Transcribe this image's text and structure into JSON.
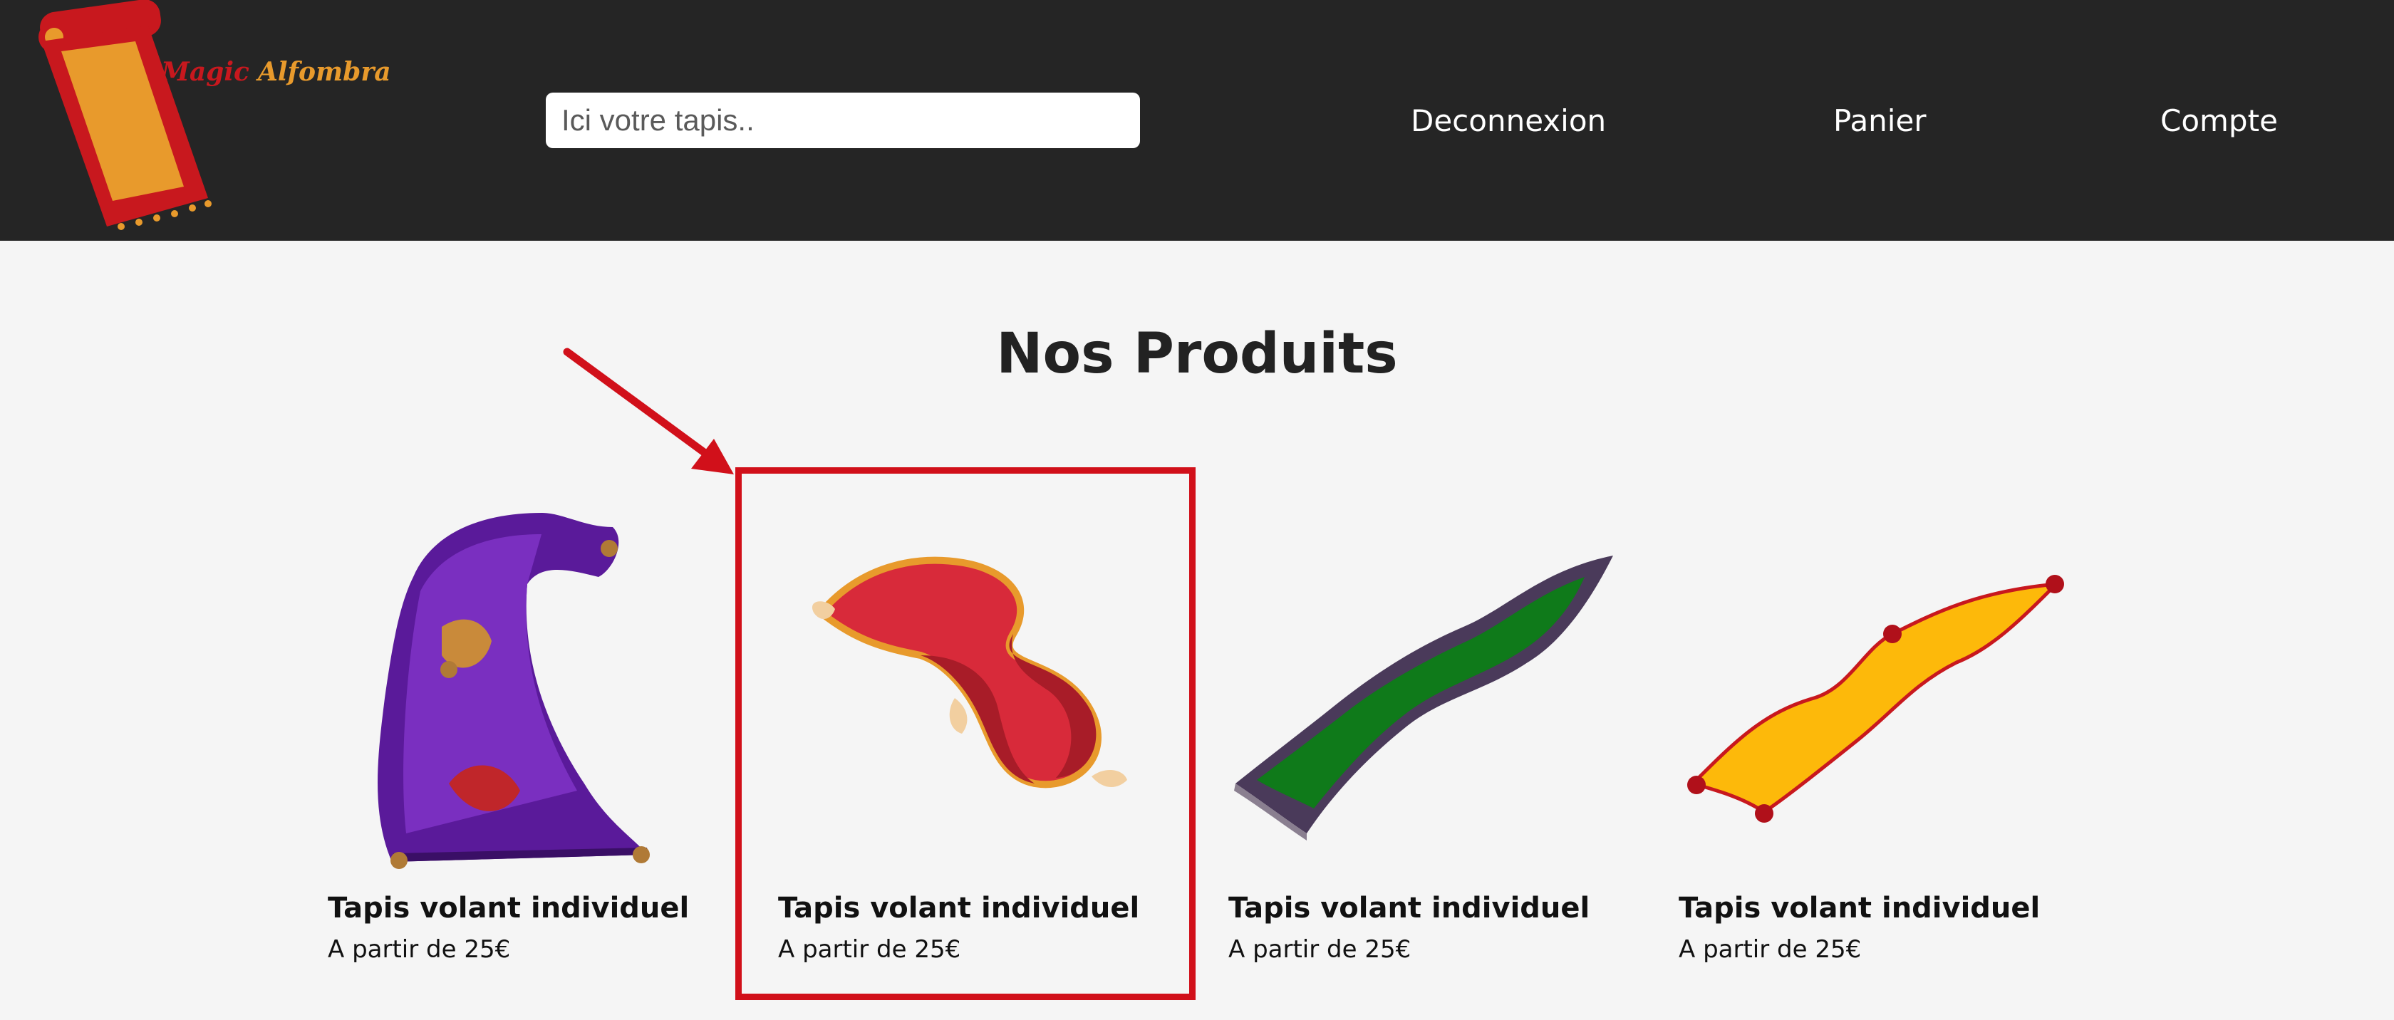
{
  "brand": {
    "name_part1": "Magic",
    "name_part2": "Alfombra",
    "colors": {
      "red": "#c8181e",
      "gold": "#e89a2c"
    }
  },
  "header": {
    "search": {
      "placeholder": "Ici votre tapis..",
      "value": ""
    },
    "nav": {
      "logout": "Deconnexion",
      "cart": "Panier",
      "account": "Compte"
    }
  },
  "main": {
    "title": "Nos Produits",
    "products": [
      {
        "name": "Tapis volant individuel",
        "price": "A partir de 25€",
        "image": "purple-magic-carpet"
      },
      {
        "name": "Tapis volant individuel",
        "price": "A partir de 25€",
        "image": "red-magic-carpet"
      },
      {
        "name": "Tapis volant individuel",
        "price": "A partir de 25€",
        "image": "green-magic-carpet"
      },
      {
        "name": "Tapis volant individuel",
        "price": "A partir de 25€",
        "image": "yellow-magic-carpet"
      }
    ]
  },
  "annotation": {
    "highlighted_product": 2,
    "color": "#d1101a"
  }
}
